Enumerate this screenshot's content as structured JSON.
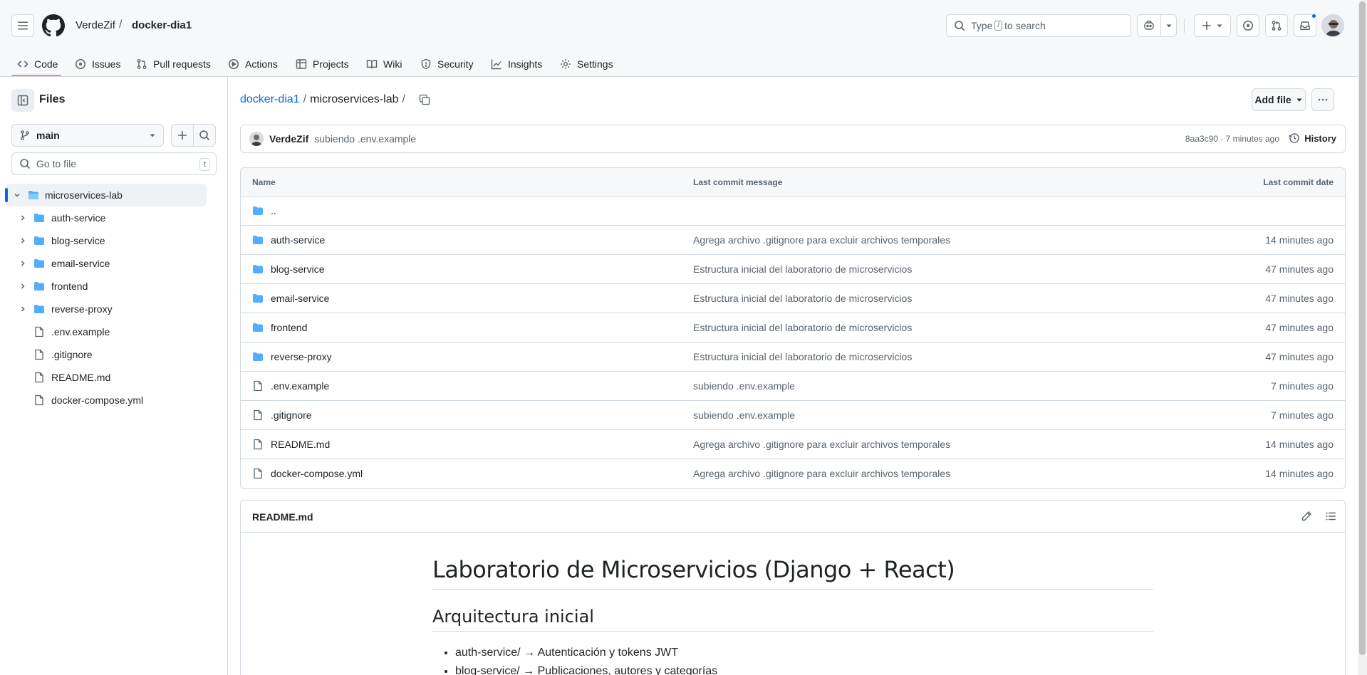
{
  "header": {
    "owner": "VerdeZif",
    "separator": "/",
    "repo": "docker-dia1",
    "search_prefix": "Type",
    "search_key": "/",
    "search_suffix": "to search"
  },
  "tabs": [
    {
      "label": "Code",
      "icon": "code-icon"
    },
    {
      "label": "Issues",
      "icon": "issue-icon"
    },
    {
      "label": "Pull requests",
      "icon": "pull-request-icon"
    },
    {
      "label": "Actions",
      "icon": "play-icon"
    },
    {
      "label": "Projects",
      "icon": "table-icon"
    },
    {
      "label": "Wiki",
      "icon": "book-icon"
    },
    {
      "label": "Security",
      "icon": "shield-icon"
    },
    {
      "label": "Insights",
      "icon": "graph-icon"
    },
    {
      "label": "Settings",
      "icon": "gear-icon"
    }
  ],
  "sidebar": {
    "title": "Files",
    "branch": "main",
    "goto_placeholder": "Go to file",
    "goto_key": "t",
    "tree": [
      {
        "label": "microservices-lab",
        "type": "dir-open",
        "depth": 0
      },
      {
        "label": "auth-service",
        "type": "dir",
        "depth": 1
      },
      {
        "label": "blog-service",
        "type": "dir",
        "depth": 1
      },
      {
        "label": "email-service",
        "type": "dir",
        "depth": 1
      },
      {
        "label": "frontend",
        "type": "dir",
        "depth": 1
      },
      {
        "label": "reverse-proxy",
        "type": "dir",
        "depth": 1
      },
      {
        "label": ".env.example",
        "type": "file",
        "depth": 1
      },
      {
        "label": ".gitignore",
        "type": "file",
        "depth": 1
      },
      {
        "label": "README.md",
        "type": "file",
        "depth": 1
      },
      {
        "label": "docker-compose.yml",
        "type": "file",
        "depth": 1
      }
    ]
  },
  "main": {
    "path_root": "docker-dia1",
    "path_dir": "microservices-lab",
    "path_sep": "/",
    "add_file": "Add file",
    "commit": {
      "author": "VerdeZif",
      "message": "subiendo .env.example",
      "meta": "8aa3c90 · 7 minutes ago",
      "history": "History"
    },
    "table_headers": {
      "name": "Name",
      "message": "Last commit message",
      "date": "Last commit date"
    },
    "files": [
      {
        "name": "..",
        "type": "dir",
        "message": "",
        "date": ""
      },
      {
        "name": "auth-service",
        "type": "dir",
        "message": "Agrega archivo .gitignore para excluir archivos temporales",
        "date": "14 minutes ago"
      },
      {
        "name": "blog-service",
        "type": "dir",
        "message": "Estructura inicial del laboratorio de microservicios",
        "date": "47 minutes ago"
      },
      {
        "name": "email-service",
        "type": "dir",
        "message": "Estructura inicial del laboratorio de microservicios",
        "date": "47 minutes ago"
      },
      {
        "name": "frontend",
        "type": "dir",
        "message": "Estructura inicial del laboratorio de microservicios",
        "date": "47 minutes ago"
      },
      {
        "name": "reverse-proxy",
        "type": "dir",
        "message": "Estructura inicial del laboratorio de microservicios",
        "date": "47 minutes ago"
      },
      {
        "name": ".env.example",
        "type": "file",
        "message": "subiendo .env.example",
        "date": "7 minutes ago"
      },
      {
        "name": ".gitignore",
        "type": "file",
        "message": "subiendo .env.example",
        "date": "7 minutes ago"
      },
      {
        "name": "README.md",
        "type": "file",
        "message": "Agrega archivo .gitignore para excluir archivos temporales",
        "date": "14 minutes ago"
      },
      {
        "name": "docker-compose.yml",
        "type": "file",
        "message": "Agrega archivo .gitignore para excluir archivos temporales",
        "date": "14 minutes ago"
      }
    ],
    "readme": {
      "title": "README.md",
      "h1": "Laboratorio de Microservicios (Django + React)",
      "h2": "Arquitectura inicial",
      "items": [
        "auth-service/ → Autenticación y tokens JWT",
        "blog-service/ → Publicaciones, autores y categorías"
      ]
    }
  },
  "colors": {
    "accent": "#0969da",
    "folder": "#54aeff",
    "tab_underline": "#fd8c73"
  }
}
